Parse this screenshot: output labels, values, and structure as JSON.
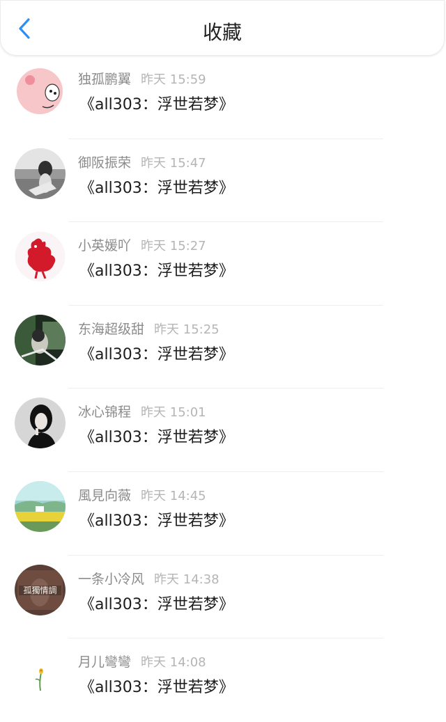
{
  "header": {
    "title": "收藏"
  },
  "items": [
    {
      "name": "独孤鹏翼",
      "time": "昨天 15:59",
      "content": "《all303：浮世若梦》"
    },
    {
      "name": "御阪振荣",
      "time": "昨天 15:47",
      "content": "《all303：浮世若梦》"
    },
    {
      "name": "小英媛吖",
      "time": "昨天 15:27",
      "content": "《all303：浮世若梦》"
    },
    {
      "name": "东海超级甜",
      "time": "昨天 15:25",
      "content": "《all303：浮世若梦》"
    },
    {
      "name": "冰心锦程",
      "time": "昨天 15:01",
      "content": "《all303：浮世若梦》"
    },
    {
      "name": "風見向薇",
      "time": "昨天 14:45",
      "content": "《all303：浮世若梦》"
    },
    {
      "name": "一条小冷风",
      "time": "昨天 14:38",
      "content": "《all303：浮世若梦》"
    },
    {
      "name": "月儿彎彎",
      "time": "昨天 14:08",
      "content": "《all303：浮世若梦》"
    }
  ],
  "colors": {
    "accent": "#2f8ef3",
    "name": "#8b8b8b",
    "time": "#b5b5b5"
  }
}
